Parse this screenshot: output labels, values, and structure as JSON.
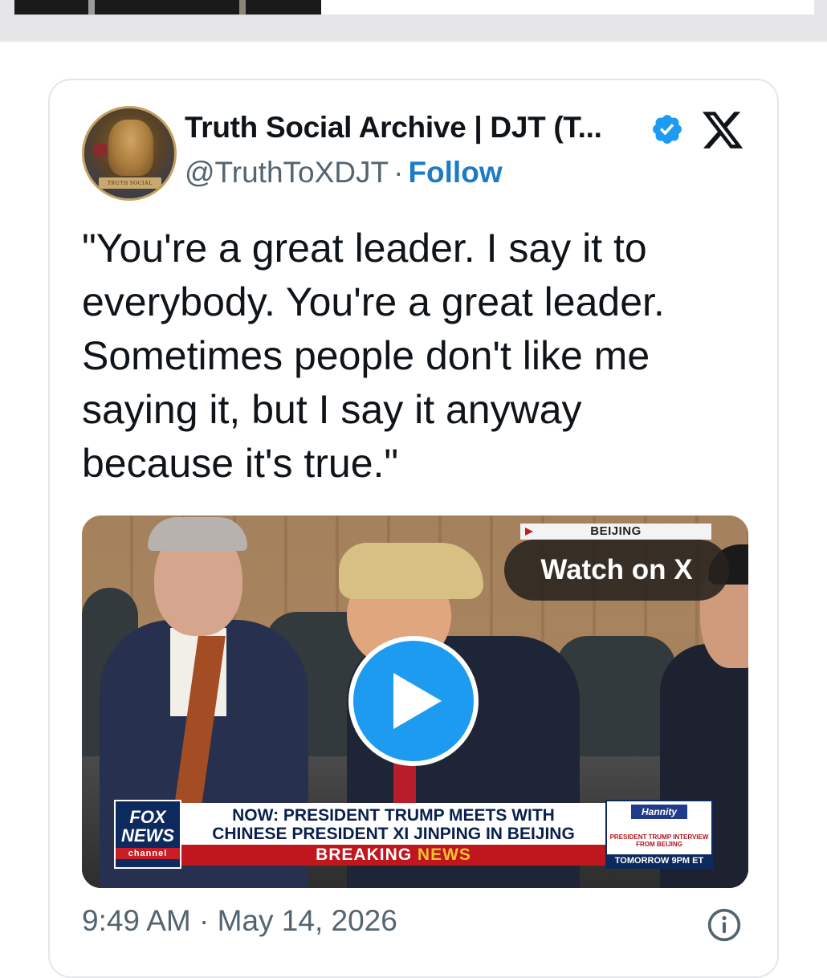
{
  "tweet": {
    "author_name": "Truth Social Archive | DJT (T...",
    "handle": "@TruthToXDJT",
    "separator": "·",
    "follow_label": "Follow",
    "avatar_plate_text": "TRUTH SOCIAL",
    "text": "\"You're a great leader. I say it to everybody. You're a great leader. Sometimes people don't like me saying it, but I say it anyway because it's true.\"",
    "timestamp": "9:49 AM · May 14, 2026"
  },
  "video": {
    "location_bug": "BEIJING",
    "watch_label": "Watch on X",
    "lower_third": {
      "network_line1": "FOX",
      "network_line2": "NEWS",
      "network_line3": "channel",
      "headline_line1": "NOW: PRESIDENT TRUMP MEETS WITH",
      "headline_line2": "CHINESE PRESIDENT XI JINPING IN BEIJING",
      "breaking_word1": "BREAKING",
      "breaking_word2": "NEWS",
      "show_name": "Hannity",
      "promo": "PRESIDENT TRUMP INTERVIEW FROM BEIJING",
      "promo_time": "TOMORROW 9PM ET"
    }
  },
  "colors": {
    "link_blue": "#1d7bc5",
    "verified_blue": "#1d9bf0",
    "muted_text": "#536471"
  },
  "icons": {
    "verified": "verified-badge-icon",
    "platform": "x-logo-icon",
    "play": "play-icon",
    "info": "info-icon"
  }
}
